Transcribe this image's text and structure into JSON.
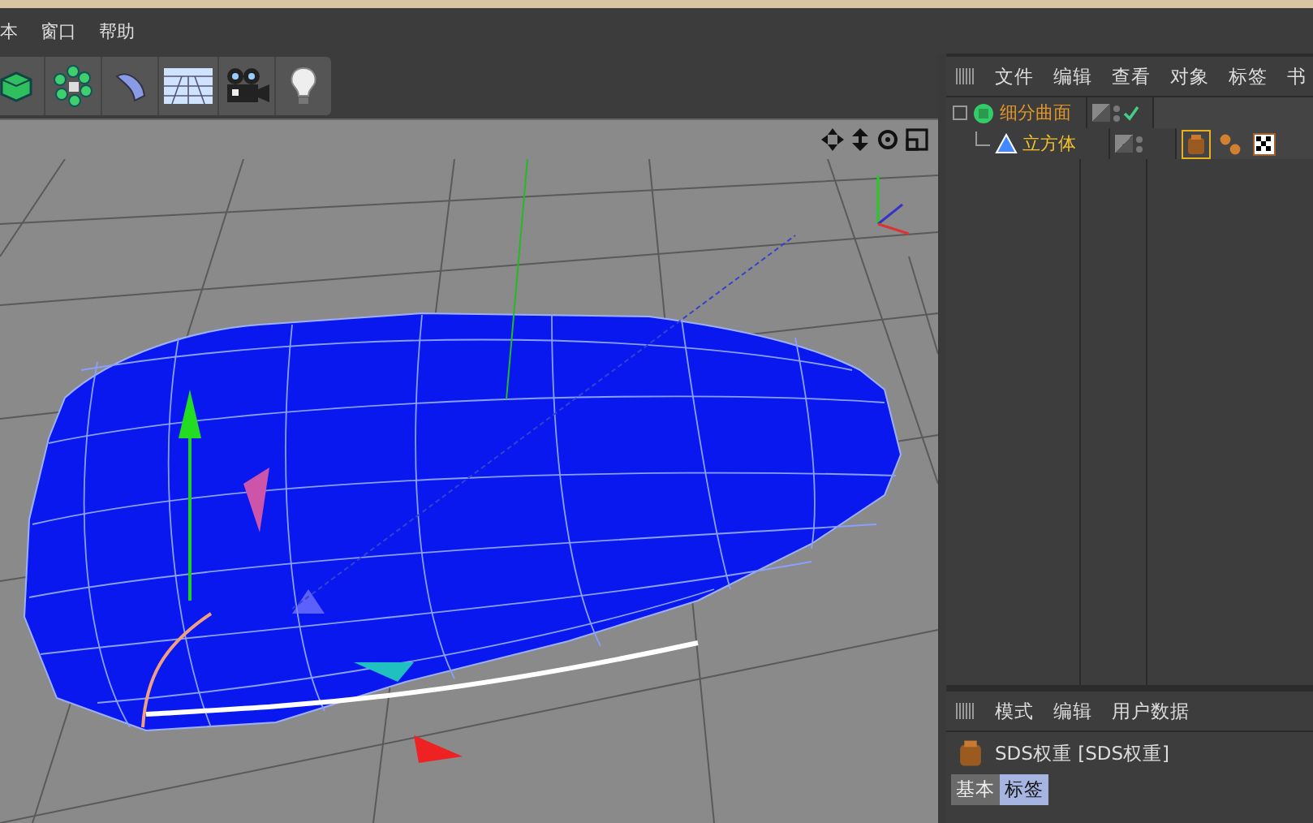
{
  "menu_bar": [
    {
      "label": "本"
    },
    {
      "label": "窗口"
    },
    {
      "label": "帮助"
    }
  ],
  "object_manager": {
    "menu": [
      "文件",
      "编辑",
      "查看",
      "对象",
      "标签",
      "书"
    ],
    "objects": [
      {
        "name": "细分曲面",
        "kind": "subdivision",
        "enabled": true,
        "children": [
          {
            "name": "立方体",
            "kind": "cube",
            "tags": [
              {
                "kind": "weight",
                "selected": true
              },
              {
                "kind": "phong",
                "selected": false
              },
              {
                "kind": "material",
                "selected": false
              }
            ]
          }
        ]
      }
    ]
  },
  "attribute_manager": {
    "menu": [
      "模式",
      "编辑",
      "用户数据"
    ],
    "title": "SDS权重 [SDS权重]",
    "tabs": [
      {
        "label": "基本",
        "selected": false
      },
      {
        "label": "标签",
        "selected": true
      }
    ]
  }
}
